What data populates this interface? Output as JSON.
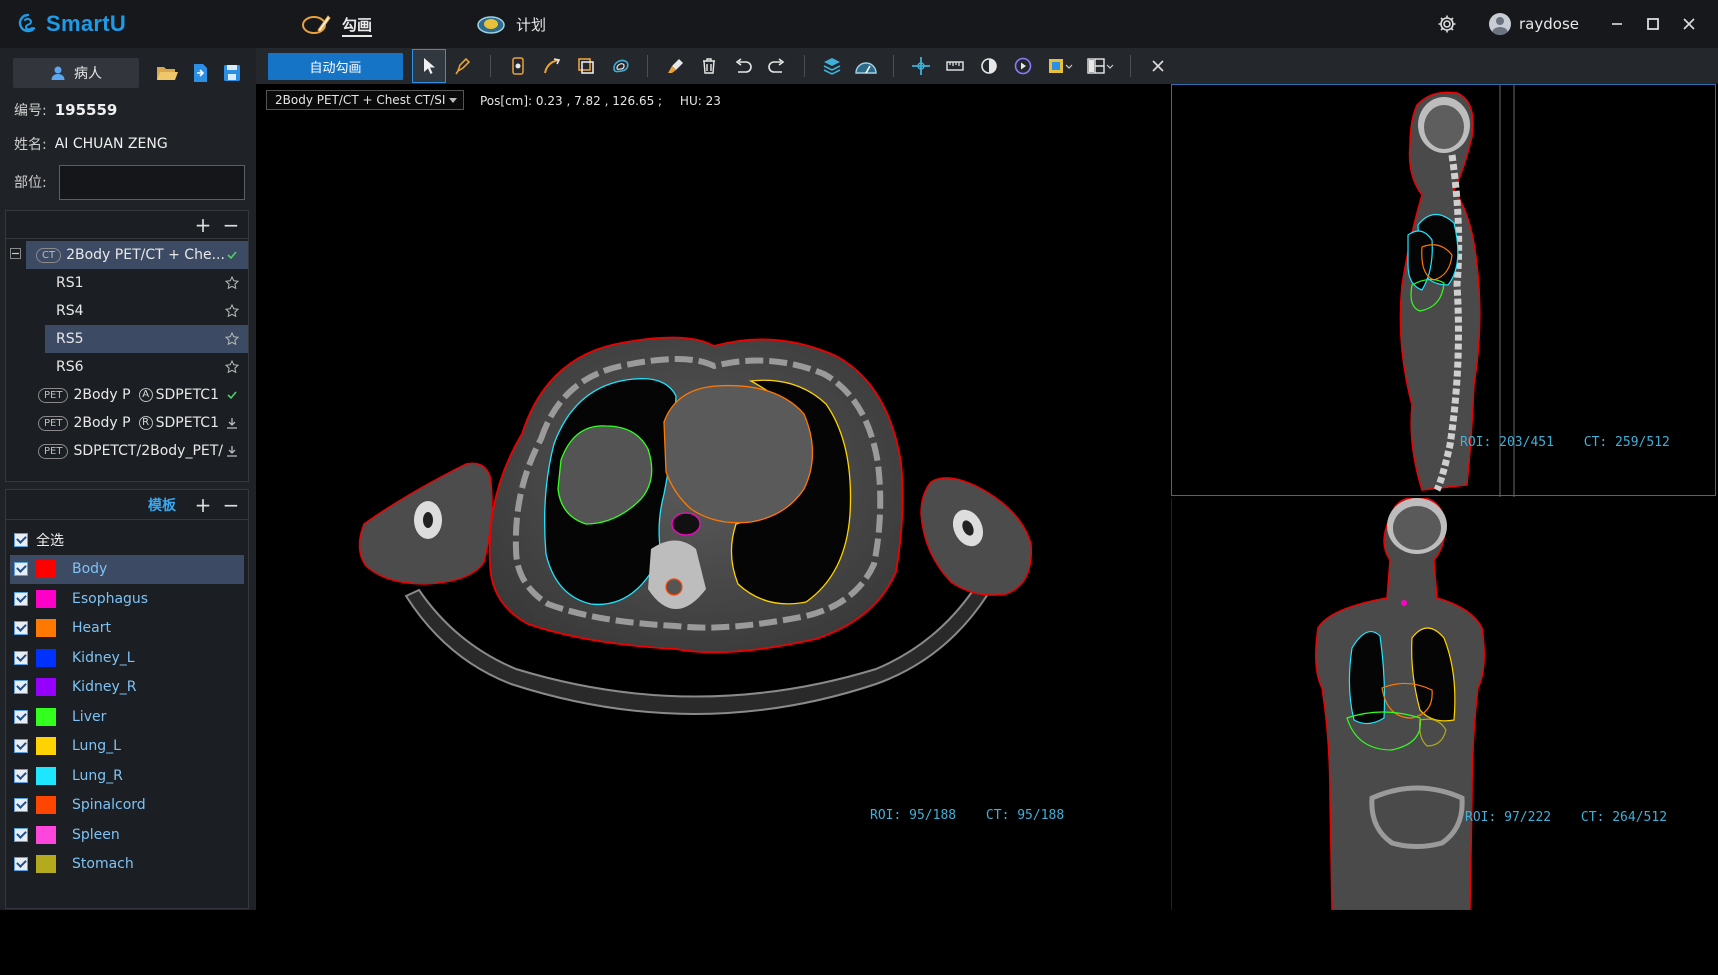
{
  "app": {
    "name": "SmartU",
    "tabs": [
      {
        "label": "勾画",
        "active": true
      },
      {
        "label": "计划",
        "active": false
      }
    ],
    "user": "raydose"
  },
  "patient": {
    "button_label": "病人",
    "id_label": "编号:",
    "id_value": "195559",
    "name_label": "姓名:",
    "name_value": "AI CHUAN ZENG",
    "site_label": "部位:",
    "site_value": ""
  },
  "tree": {
    "items": [
      {
        "badge": "CT",
        "label": "2Body PET/CT + Che...",
        "status": "check",
        "selected": true,
        "level": 0
      },
      {
        "label": "RS1",
        "status": "star",
        "level": 1
      },
      {
        "label": "RS4",
        "status": "star",
        "level": 1
      },
      {
        "label": "RS5",
        "status": "star",
        "selected": true,
        "level": 1
      },
      {
        "label": "RS6",
        "status": "star",
        "level": 1
      },
      {
        "badge": "PET",
        "label": "2Body P",
        "marker": "A",
        "label2": "SDPETC1",
        "status": "check",
        "level": 0
      },
      {
        "badge": "PET",
        "label": "2Body P",
        "marker": "R",
        "label2": "SDPETC1",
        "status": "download",
        "level": 0
      },
      {
        "badge": "PET",
        "label": "SDPETCT/2Body_PET/",
        "status": "download",
        "level": 0
      }
    ]
  },
  "template": {
    "title": "模板",
    "select_all": "全选",
    "rois": [
      {
        "name": "Body",
        "color": "#ff0000",
        "selected": true
      },
      {
        "name": "Esophagus",
        "color": "#ff00c8"
      },
      {
        "name": "Heart",
        "color": "#ff7800"
      },
      {
        "name": "Kidney_L",
        "color": "#0032ff"
      },
      {
        "name": "Kidney_R",
        "color": "#9600ff"
      },
      {
        "name": "Liver",
        "color": "#32ff1e"
      },
      {
        "name": "Lung_L",
        "color": "#ffd200"
      },
      {
        "name": "Lung_R",
        "color": "#1ee6ff"
      },
      {
        "name": "Spinalcord",
        "color": "#ff4600"
      },
      {
        "name": "Spleen",
        "color": "#ff46dc"
      },
      {
        "name": "Stomach",
        "color": "#b4aa1e"
      }
    ]
  },
  "toolbar": {
    "auto_contour": "自动勾画"
  },
  "viewer": {
    "series": "2Body PET/CT + Chest CT/SI",
    "pos": "Pos[cm]: 0.23 , 7.82 , 126.65 ;",
    "hu": "HU: 23",
    "axial": {
      "roi": "ROI: 95/188",
      "ct": "CT: 95/188"
    },
    "sagittal": {
      "roi": "ROI: 203/451",
      "ct": "CT: 259/512"
    },
    "coronal": {
      "roi": "ROI: 97/222",
      "ct": "CT: 264/512"
    }
  }
}
